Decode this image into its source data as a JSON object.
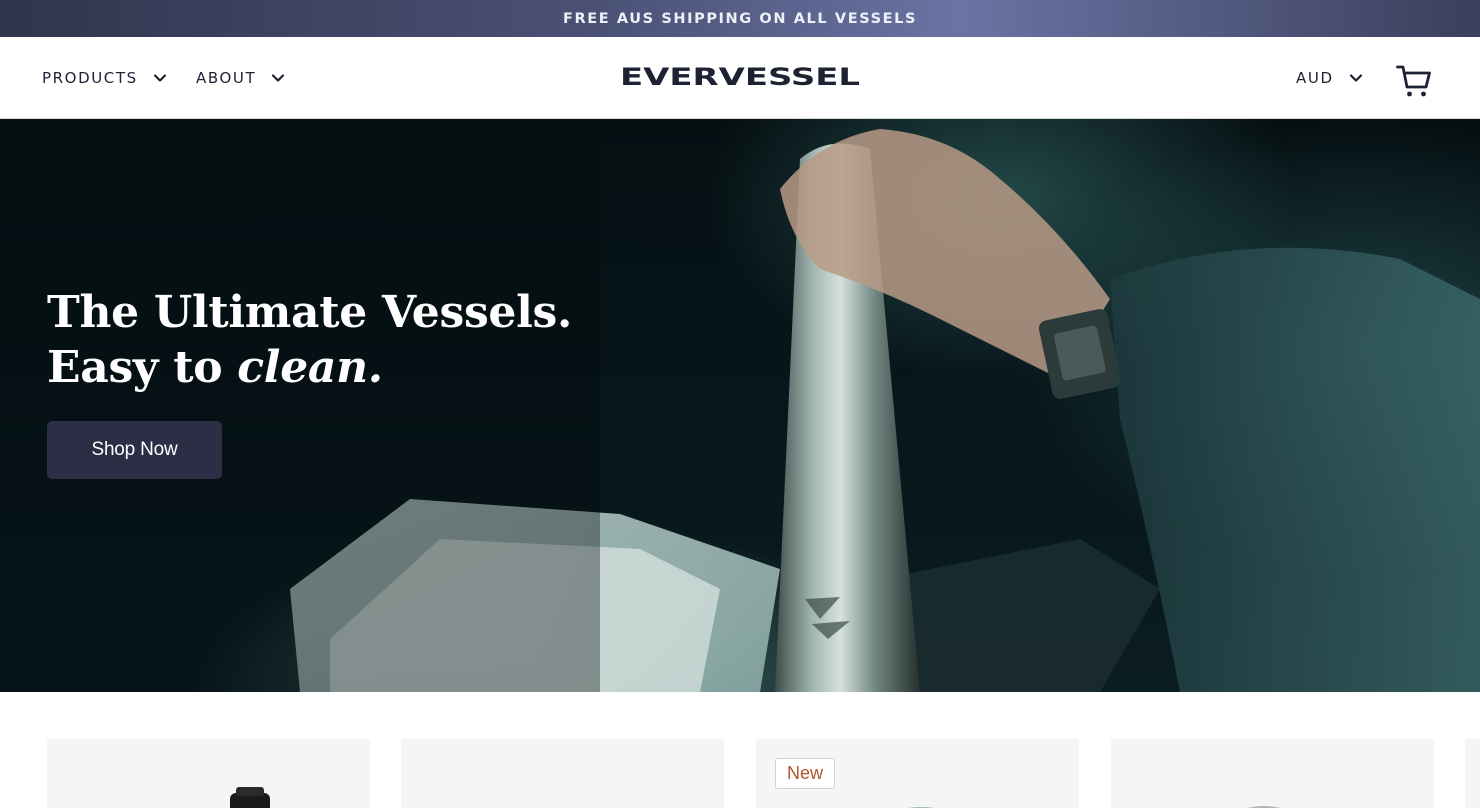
{
  "announcement": {
    "text": "FREE AUS SHIPPING ON ALL VESSELS"
  },
  "header": {
    "nav": [
      {
        "label": "PRODUCTS",
        "icon": "chevron-down-icon"
      },
      {
        "label": "ABOUT",
        "icon": "chevron-down-icon"
      }
    ],
    "logo_text": "EVERVESSEL",
    "currency": {
      "label": "AUD",
      "icon": "chevron-down-icon"
    },
    "cart_icon": "cart-icon"
  },
  "hero": {
    "title_line1": "The Ultimate Vessels.",
    "title_line2_prefix": "Easy to ",
    "title_line2_emphasis": "clean.",
    "cta_label": "Shop Now"
  },
  "products": {
    "cards": [
      {
        "badge": ""
      },
      {
        "badge": ""
      },
      {
        "badge": "New"
      },
      {
        "badge": ""
      }
    ]
  },
  "colors": {
    "brand_navy": "#1d2233",
    "button_bg": "#2b2e45",
    "badge_text": "#b5542a",
    "card_bg": "#f5f5f5"
  }
}
